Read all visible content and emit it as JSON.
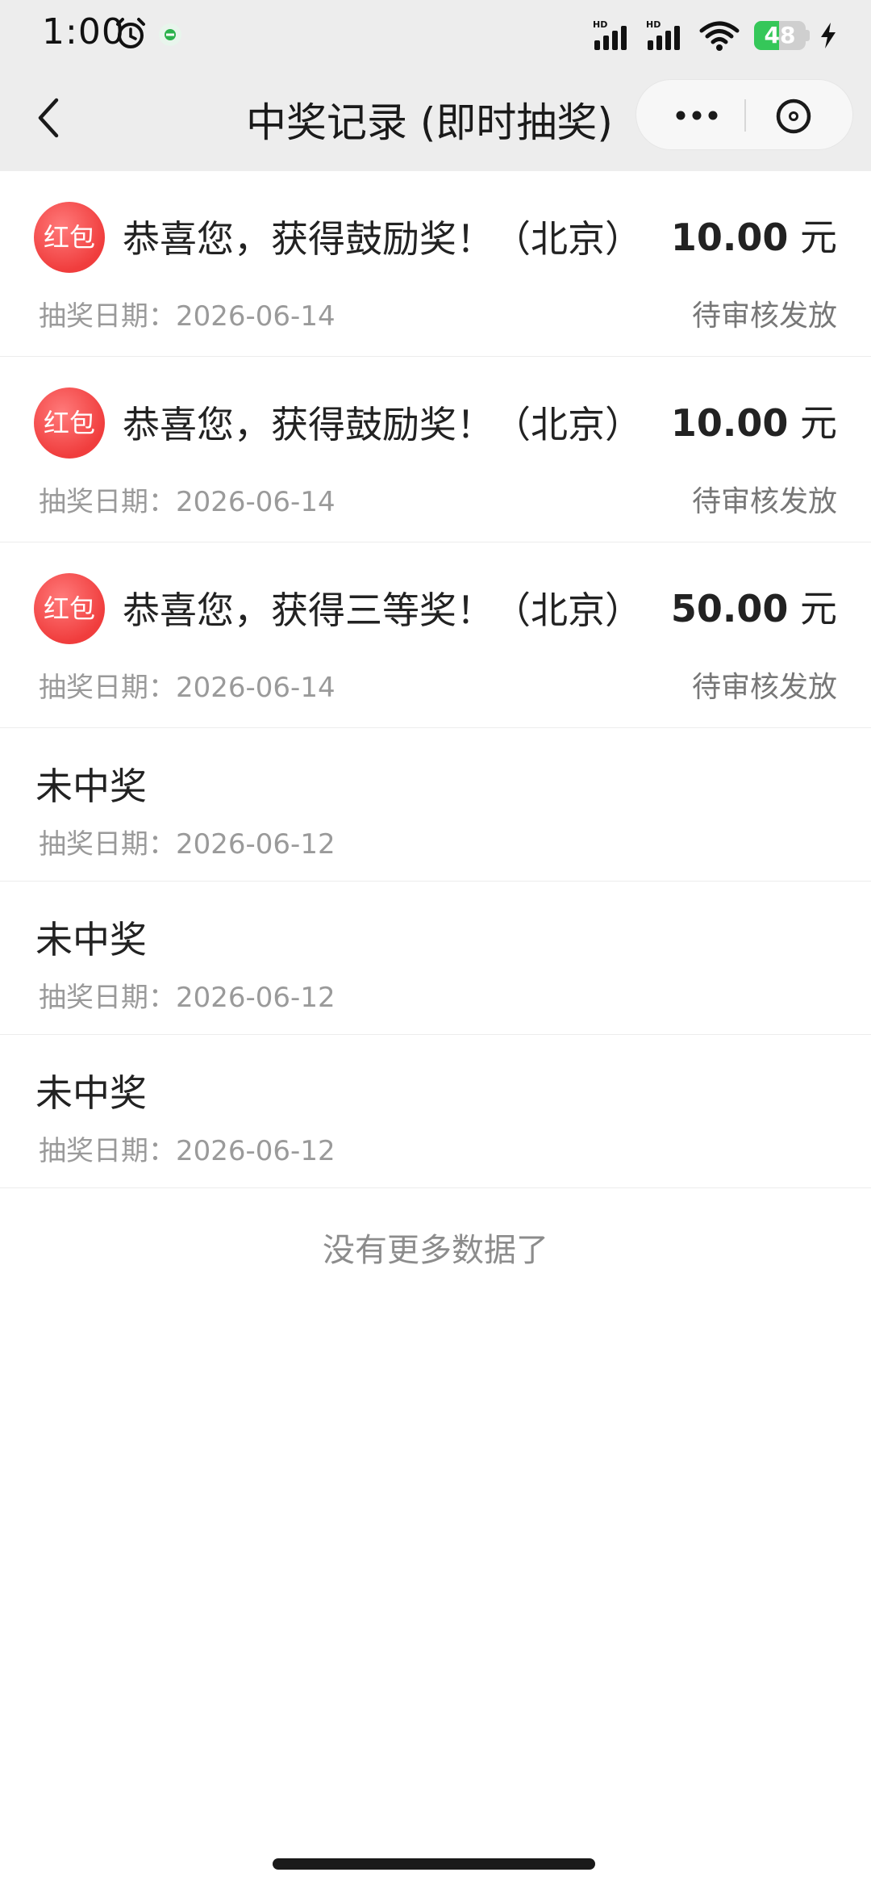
{
  "status_bar": {
    "time": "1:00",
    "battery_level": "48",
    "battery_fraction": 0.48
  },
  "nav": {
    "title": "中奖记录 (即时抽奖)",
    "back_icon": "chevron-left-icon",
    "more_icon": "more-dots-icon",
    "close_icon": "close-circle-icon"
  },
  "colors": {
    "badge_red": "#f03d3d",
    "nav_bg": "#ededed",
    "battery_green": "#35c759"
  },
  "records": [
    {
      "type": "win",
      "badge": "红包",
      "title": "恭喜您，获得鼓励奖！（北京）",
      "amount": "10.00",
      "unit": "元",
      "date_label": "抽奖日期：",
      "date": "2026-06-14",
      "status": "待审核发放"
    },
    {
      "type": "win",
      "badge": "红包",
      "title": "恭喜您，获得鼓励奖！（北京）",
      "amount": "10.00",
      "unit": "元",
      "date_label": "抽奖日期：",
      "date": "2026-06-14",
      "status": "待审核发放"
    },
    {
      "type": "win",
      "badge": "红包",
      "title": "恭喜您，获得三等奖！（北京）",
      "amount": "50.00",
      "unit": "元",
      "date_label": "抽奖日期：",
      "date": "2026-06-14",
      "status": "待审核发放"
    },
    {
      "type": "lose",
      "title": "未中奖",
      "date_label": "抽奖日期：",
      "date": "2026-06-12"
    },
    {
      "type": "lose",
      "title": "未中奖",
      "date_label": "抽奖日期：",
      "date": "2026-06-12"
    },
    {
      "type": "lose",
      "title": "未中奖",
      "date_label": "抽奖日期：",
      "date": "2026-06-12"
    }
  ],
  "footer": {
    "no_more": "没有更多数据了"
  }
}
